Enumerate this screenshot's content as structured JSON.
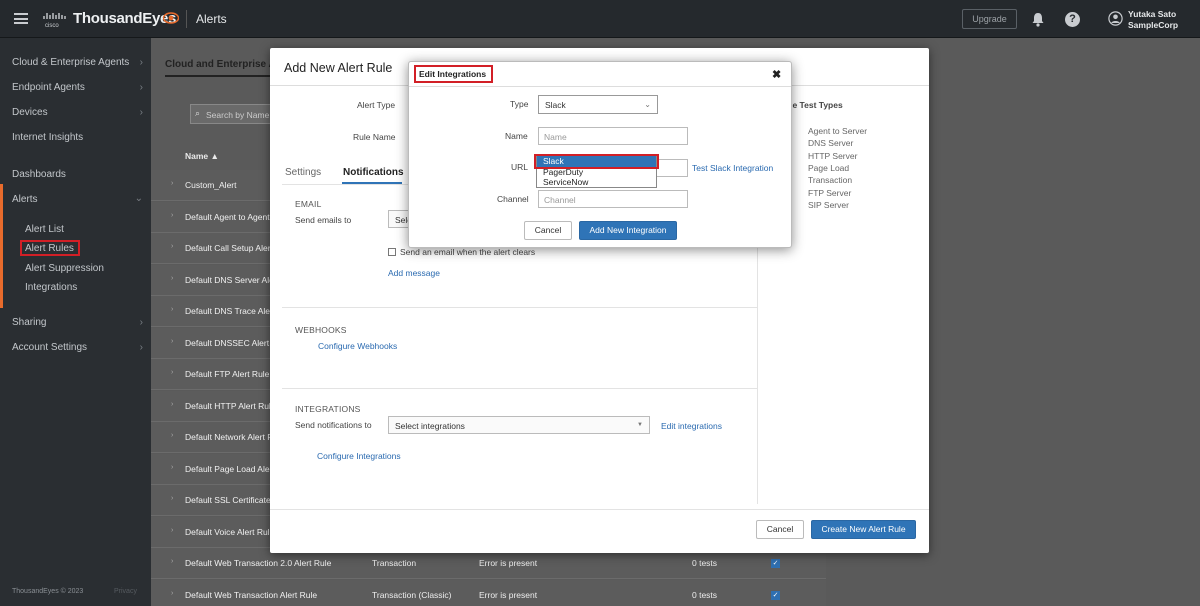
{
  "topbar": {
    "brand": "ThousandEyes",
    "section": "Alerts",
    "upgrade_label": "Upgrade",
    "user_name": "Yutaka Sato",
    "user_org": "SampleCorp"
  },
  "sidebar": {
    "items": [
      {
        "label": "Cloud & Enterprise Agents"
      },
      {
        "label": "Endpoint Agents"
      },
      {
        "label": "Devices"
      },
      {
        "label": "Internet Insights"
      },
      {
        "label": "Dashboards"
      },
      {
        "label": "Alerts"
      },
      {
        "label": "Sharing"
      },
      {
        "label": "Account Settings"
      }
    ],
    "alerts_sub": [
      "Alert List",
      "Alert Rules",
      "Alert Suppression",
      "Integrations"
    ],
    "footer": "ThousandEyes © 2023",
    "privacy": "Privacy"
  },
  "background": {
    "tab_label": "Cloud and Enterprise A",
    "search_placeholder": "Search by Name",
    "col_name": "Name",
    "rows": [
      "Custom_Alert",
      "Default Agent to Agent",
      "Default Call Setup Alert",
      "Default DNS Server Ale",
      "Default DNS Trace Aler",
      "Default DNSSEC Alert",
      "Default FTP Alert Rule",
      "Default HTTP Alert Rul",
      "Default Network Alert R",
      "Default Page Load Aler",
      "Default SSL Certificate",
      "Default Voice Alert Rule",
      "Default Web Transaction 2.0 Alert Rule",
      "Default Web Transaction Alert Rule"
    ],
    "row13_type": "Transaction",
    "row13_cond": "Error is present",
    "row13_tests": "0 tests",
    "row14_type": "Transaction (Classic)",
    "row14_cond": "Error is present",
    "row14_tests": "0 tests",
    "compat_title": "atible Test Types",
    "compat_prefix": "rk",
    "compat_types": [
      "Agent to Server",
      "DNS Server",
      "HTTP Server",
      "Page Load",
      "Transaction",
      "FTP Server",
      "SIP Server"
    ]
  },
  "modal": {
    "title": "Add New Alert Rule",
    "alert_type_label": "Alert Type",
    "rule_name_label": "Rule Name",
    "tab_settings": "Settings",
    "tab_notifications": "Notifications",
    "email_heading": "EMAIL",
    "send_emails_label": "Send emails to",
    "send_emails_value": "Selec",
    "email_clear_label": "Send an email when the alert clears",
    "add_message": "Add message",
    "webhooks_heading": "WEBHOOKS",
    "configure_webhooks": "Configure Webhooks",
    "integrations_heading": "INTEGRATIONS",
    "send_notifications_label": "Send notifications to",
    "select_integrations": "Select integrations",
    "edit_integrations": "Edit integrations",
    "configure_integrations": "Configure Integrations",
    "cancel": "Cancel",
    "create": "Create New Alert Rule"
  },
  "dialog": {
    "title": "Edit Integrations",
    "type_label": "Type",
    "type_value": "Slack",
    "name_label": "Name",
    "name_placeholder": "Name",
    "url_label": "URL",
    "url_options": [
      "Slack",
      "PagerDuty",
      "ServiceNow"
    ],
    "test_link": "Test Slack Integration",
    "channel_label": "Channel",
    "channel_placeholder": "Channel",
    "cancel": "Cancel",
    "add": "Add New Integration"
  },
  "colors": {
    "accent": "#2f74b7",
    "highlight_red": "#d21f26",
    "brand_orange": "#e86b2c"
  }
}
